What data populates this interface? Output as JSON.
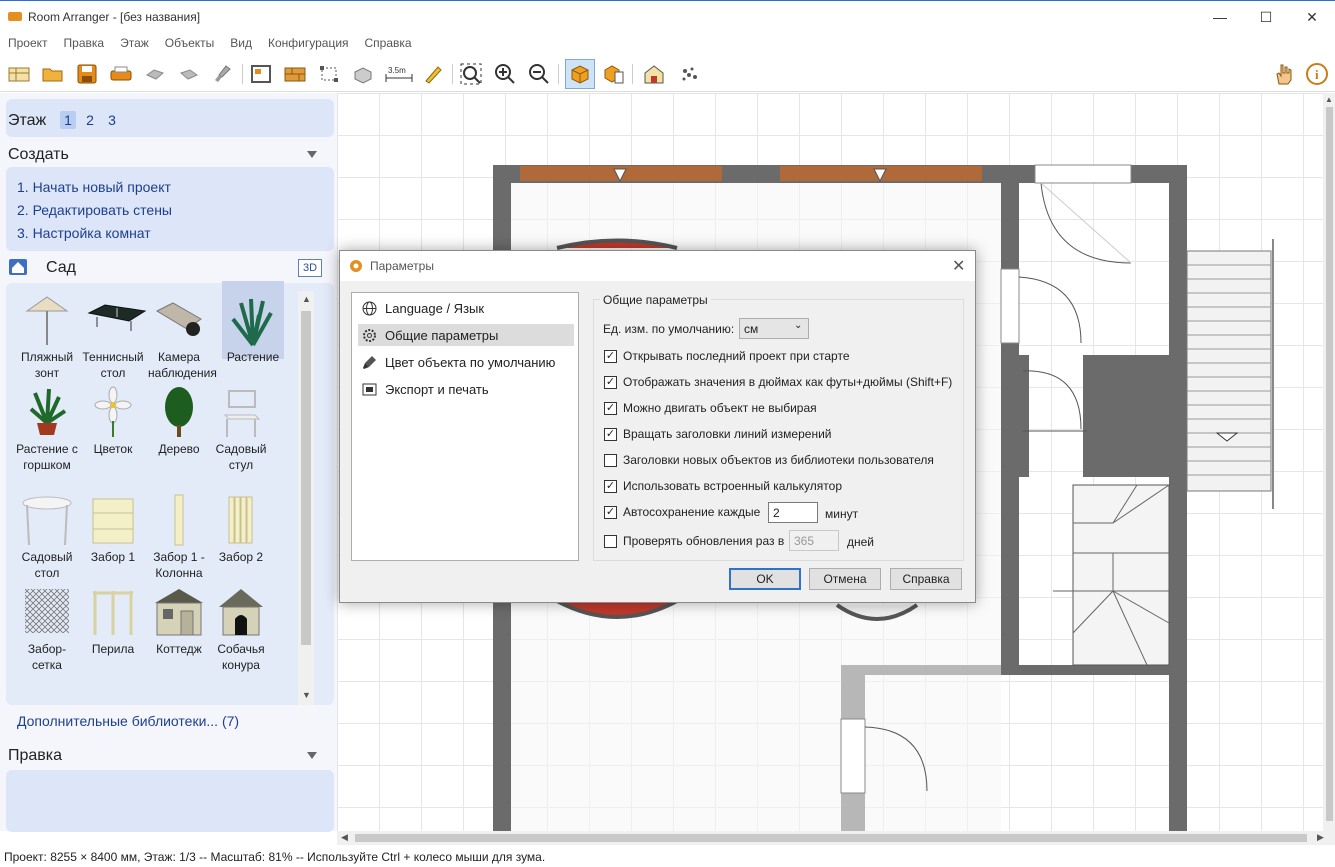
{
  "window": {
    "title": "Room Arranger - [без названия]",
    "controls": {
      "minimize": "—",
      "maximize": "☐",
      "close": "✕"
    }
  },
  "menu": [
    "Проект",
    "Правка",
    "Этаж",
    "Объекты",
    "Вид",
    "Конфигурация",
    "Справка"
  ],
  "toolbar": {
    "icons": [
      "new-project-icon",
      "open-icon",
      "save-icon",
      "print-icon",
      "undo-icon",
      "redo-icon",
      "brush-icon",
      "room-icon",
      "wall-icon",
      "select-icon",
      "3d-object-icon",
      "measure-icon",
      "pencil-icon",
      "zoom-fit-icon",
      "zoom-in-icon",
      "zoom-out-icon",
      "3d-view-icon",
      "3d-view-2-icon",
      "house-3d-icon",
      "render-icon",
      "hand-icon",
      "info-icon"
    ],
    "measure_label": "3.5m"
  },
  "left": {
    "floor_label": "Этаж",
    "floors": [
      "1",
      "2",
      "3"
    ],
    "create_heading": "Создать",
    "create_links": [
      "1. Начать новый проект",
      "2. Редактировать стены",
      "3. Настройка комнат"
    ],
    "library_name": "Сад",
    "library_3d": "3D",
    "items": [
      {
        "label": "Пляжный зонт"
      },
      {
        "label": "Теннисный стол"
      },
      {
        "label": "Камера наблюдения"
      },
      {
        "label": "Растение"
      },
      {
        "label": "Растение с горшком"
      },
      {
        "label": "Цветок"
      },
      {
        "label": "Дерево"
      },
      {
        "label": "Садовый стул"
      },
      {
        "label": "Садовый стол"
      },
      {
        "label": "Забор 1"
      },
      {
        "label": "Забор 1 - Колонна"
      },
      {
        "label": "Забор 2"
      },
      {
        "label": "Забор-сетка"
      },
      {
        "label": "Перила"
      },
      {
        "label": "Коттедж"
      },
      {
        "label": "Собачья конура"
      }
    ],
    "more_libraries": "Дополнительные библиотеки... (7)",
    "edit_heading": "Правка"
  },
  "dialog": {
    "title": "Параметры",
    "nav": [
      "Language / Язык",
      "Общие параметры",
      "Цвет объекта по умолчанию",
      "Экспорт и печать"
    ],
    "group_title": "Общие параметры",
    "unit_label": "Ед. изм. по умолчанию:",
    "unit_value": "см",
    "options": [
      {
        "label": "Открывать последний проект при старте",
        "checked": true
      },
      {
        "label": "Отображать значения в дюймах как футы+дюймы (Shift+F)",
        "checked": true
      },
      {
        "label": "Можно двигать объект не выбирая",
        "checked": true
      },
      {
        "label": "Вращать заголовки линий измерений",
        "checked": true
      },
      {
        "label": "Заголовки новых объектов из библиотеки пользователя",
        "checked": false
      },
      {
        "label": "Использовать встроенный калькулятор",
        "checked": true
      }
    ],
    "autosave_label": "Автосохранение каждые",
    "autosave_value": "2",
    "autosave_unit": "минут",
    "autosave_checked": true,
    "updates_label": "Проверять обновления раз в",
    "updates_value": "365",
    "updates_unit": "дней",
    "updates_checked": false,
    "buttons": {
      "ok": "OK",
      "cancel": "Отмена",
      "help": "Справка"
    }
  },
  "statusbar": "Проект: 8255 × 8400 мм, Этаж: 1/3 -- Масштаб: 81% -- Используйте Ctrl + колесо мыши для зума."
}
